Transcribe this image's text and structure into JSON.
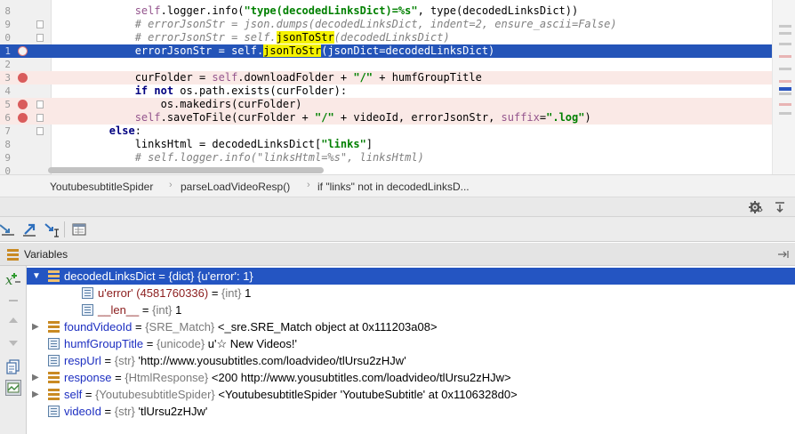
{
  "editor": {
    "lines": [
      {
        "num": "8",
        "parts": [
          [
            "",
            "            "
          ],
          [
            "slf",
            "self"
          ],
          [
            "",
            ".logger.info("
          ],
          [
            "str",
            "\"type(decodedLinksDict)=%s\""
          ],
          [
            "",
            ", type(decodedLinksDict))"
          ]
        ]
      },
      {
        "num": "9",
        "parts": [
          [
            "cmt",
            "            # errorJsonStr = json.dumps(decodedLinksDict, indent=2, ensure_ascii=False)"
          ]
        ]
      },
      {
        "num": "0",
        "parts": [
          [
            "cmt",
            "            # errorJsonStr = self."
          ],
          [
            "hl",
            "jsonToStr"
          ],
          [
            "cmt",
            "(decodedLinksDict)"
          ]
        ]
      },
      {
        "num": "1",
        "parts": [
          [
            "",
            "            errorJsonStr = self."
          ],
          [
            "hl",
            "jsonToStr"
          ],
          [
            "",
            "(jsonDict=decodedLinksDict)"
          ]
        ]
      },
      {
        "num": "2",
        "parts": [
          [
            "",
            ""
          ]
        ]
      },
      {
        "num": "3",
        "parts": [
          [
            "",
            "            curFolder = "
          ],
          [
            "slf",
            "self"
          ],
          [
            "",
            ".downloadFolder + "
          ],
          [
            "str",
            "\"/\""
          ],
          [
            "",
            " + humfGroupTitle"
          ]
        ]
      },
      {
        "num": "4",
        "parts": [
          [
            "",
            "            "
          ],
          [
            "kw",
            "if not"
          ],
          [
            "",
            " os.path.exists(curFolder):"
          ]
        ]
      },
      {
        "num": "5",
        "parts": [
          [
            "",
            "                os.makedirs(curFolder)"
          ]
        ]
      },
      {
        "num": "6",
        "parts": [
          [
            "",
            "            "
          ],
          [
            "slf",
            "self"
          ],
          [
            "",
            ".saveToFile(curFolder + "
          ],
          [
            "str",
            "\"/\""
          ],
          [
            "",
            " + videoId, errorJsonStr, "
          ],
          [
            "slf",
            "suffix"
          ],
          [
            "",
            "="
          ],
          [
            "str",
            "\".log\""
          ],
          [
            "",
            ")"
          ]
        ]
      },
      {
        "num": "7",
        "parts": [
          [
            "",
            "        "
          ],
          [
            "kw",
            "else"
          ],
          [
            "",
            ":"
          ]
        ]
      },
      {
        "num": "8",
        "parts": [
          [
            "",
            "            linksHtml = decodedLinksDict["
          ],
          [
            "str",
            "\"links\""
          ],
          [
            "",
            "]"
          ]
        ]
      },
      {
        "num": "9",
        "parts": [
          [
            "cmt",
            "            # self.logger.info(\"linksHtml=%s\", linksHtml)"
          ]
        ]
      },
      {
        "num": "0",
        "parts": [
          [
            "",
            ""
          ]
        ]
      }
    ]
  },
  "breadcrumb": {
    "items": [
      "YoutubesubtitleSpider",
      "parseLoadVideoResp()",
      "if \"links\" not in decodedLinksD..."
    ]
  },
  "variables_panel": {
    "title": "Variables"
  },
  "variables": [
    {
      "name": "decodedLinksDict",
      "type": "{dict}",
      "value": "{u'error': 1}",
      "selected": true,
      "expandable": true,
      "expanded": true,
      "indent": 0
    },
    {
      "name": "u'error' (4581760336)",
      "type": "{int}",
      "value": "1",
      "special": true,
      "indent": 1
    },
    {
      "name": "__len__",
      "type": "{int}",
      "value": "1",
      "special": true,
      "indent": 1
    },
    {
      "name": "foundVideoId",
      "type": "{SRE_Match}",
      "value": "<_sre.SRE_Match object at 0x111203a08>",
      "expandable": true,
      "indent": 0
    },
    {
      "name": "humfGroupTitle",
      "type": "{unicode}",
      "value": "u'☆ New Videos!'",
      "indent": 0
    },
    {
      "name": "respUrl",
      "type": "{str}",
      "value": "'http://www.yousubtitles.com/loadvideo/tlUrsu2zHJw'",
      "indent": 0
    },
    {
      "name": "response",
      "type": "{HtmlResponse}",
      "value": "<200 http://www.yousubtitles.com/loadvideo/tlUrsu2zHJw>",
      "expandable": true,
      "indent": 0
    },
    {
      "name": "self",
      "type": "{YoutubesubtitleSpider}",
      "value": "<YoutubesubtitleSpider 'YoutubeSubtitle' at 0x1106328d0>",
      "expandable": true,
      "indent": 0
    },
    {
      "name": "videoId",
      "type": "{str}",
      "value": "'tlUrsu2zHJw'",
      "indent": 0
    }
  ]
}
